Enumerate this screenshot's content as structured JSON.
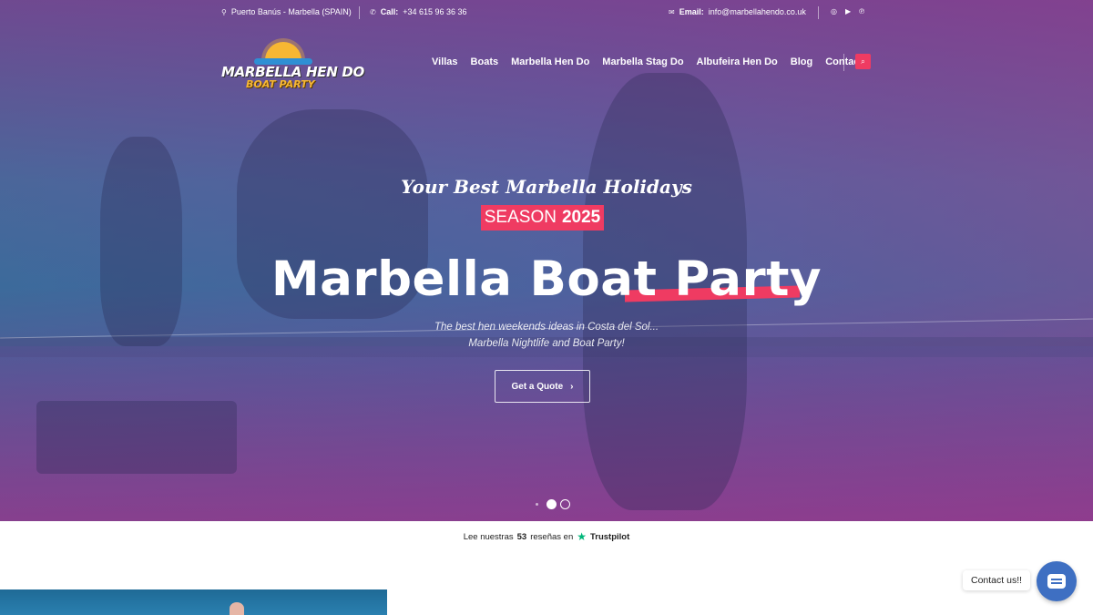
{
  "topbar": {
    "location": "Puerto Banús - Marbella (SPAIN)",
    "call_label": "Call:",
    "call_value": "+34 615 96 36 36",
    "email_label": "Email:",
    "email_value": "info@marbellahendo.co.uk"
  },
  "social": [
    {
      "icon": "instagram-icon"
    },
    {
      "icon": "youtube-icon"
    },
    {
      "icon": "pinterest-icon"
    }
  ],
  "logo": {
    "line1": "MARBELLA HEN DO",
    "line2": "BOAT PARTY"
  },
  "nav": {
    "items": [
      "Villas",
      "Boats",
      "Marbella Hen Do",
      "Marbella Stag Do",
      "Albufeira Hen Do",
      "Blog",
      "Contact"
    ]
  },
  "hero": {
    "tagline": "Your Best Marbella Holidays",
    "season_label": "SEASON",
    "season_year": "2025",
    "headline": "Marbella Boat Party",
    "subtitle_line1": "The best hen weekends ideas in Costa del Sol...",
    "subtitle_line2": "Marbella Nightlife and Boat Party!",
    "cta_label": "Get a Quote",
    "slides": 2,
    "active_slide": 1
  },
  "trustpilot": {
    "prefix": "Lee nuestras",
    "count": "53",
    "suffix": "reseñas en",
    "brand": "Trustpilot"
  },
  "contact_widget": {
    "label": "Contact us!!"
  },
  "colors": {
    "accent": "#ef3b62",
    "widget": "#3e6fc2",
    "logo_sun": "#f7b733",
    "trustpilot_green": "#00b67a"
  }
}
